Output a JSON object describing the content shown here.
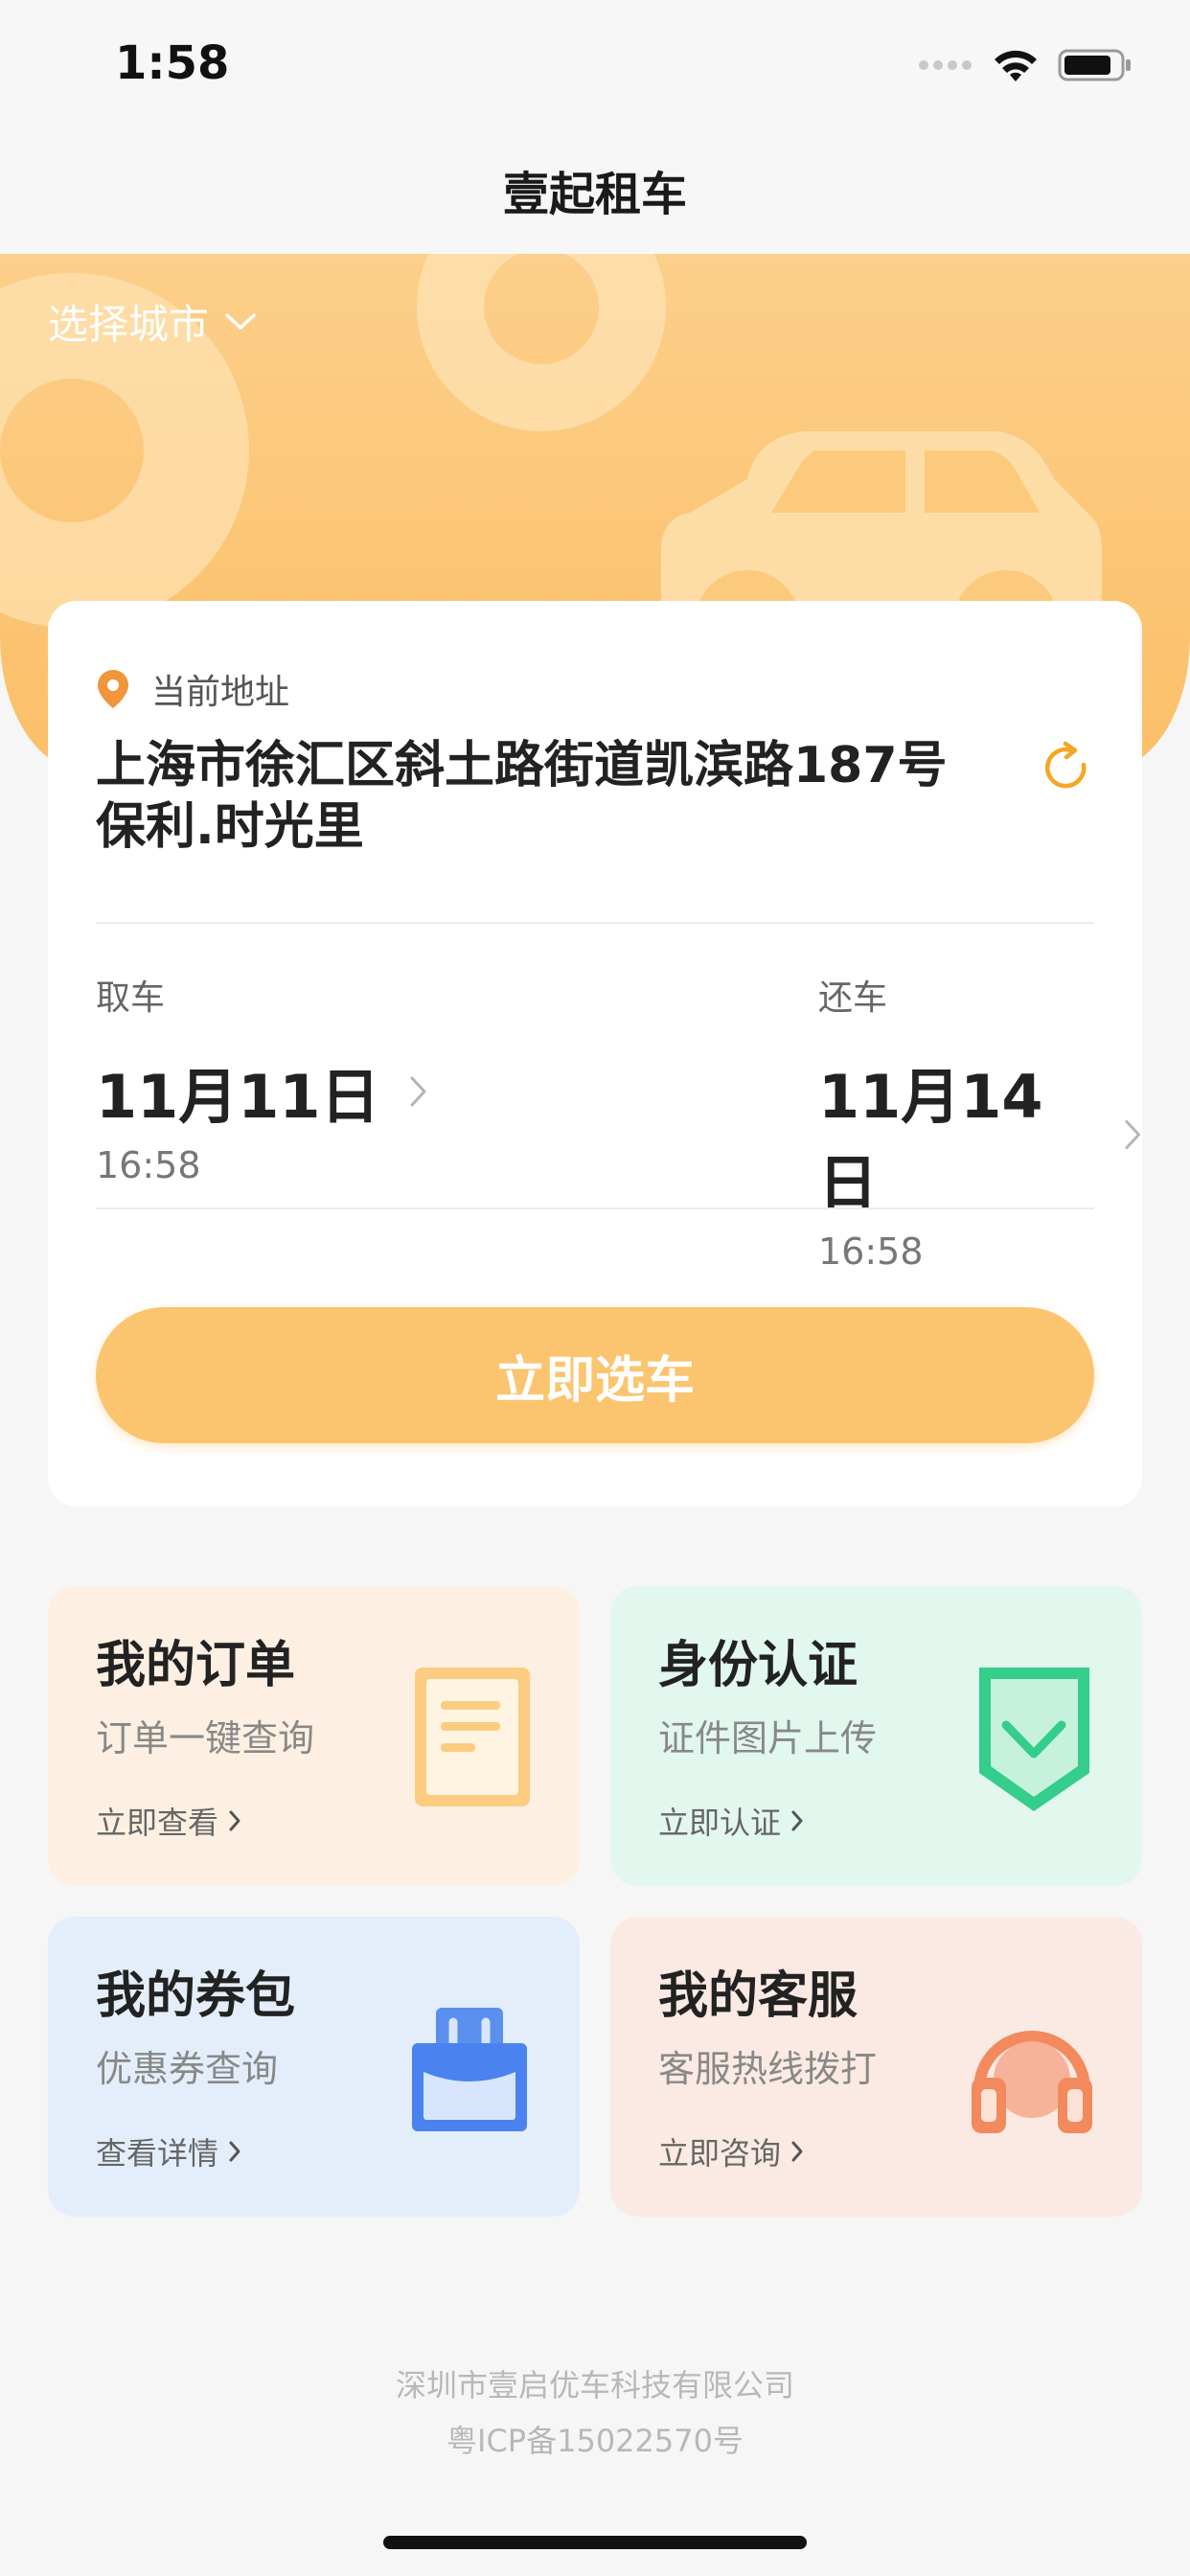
{
  "status": {
    "time": "1:58"
  },
  "nav": {
    "title": "壹起租车"
  },
  "banner": {
    "city_select": "选择城市"
  },
  "address": {
    "label": "当前地址",
    "line1": "上海市徐汇区斜土路街道凯滨路187号",
    "line2": "保利.时光里"
  },
  "pickup": {
    "label": "取车",
    "date": "11月11日",
    "time": "16:58"
  },
  "return": {
    "label": "还车",
    "date": "11月14日",
    "time": "16:58"
  },
  "cta": {
    "label": "立即选车"
  },
  "tiles": [
    {
      "title": "我的订单",
      "subtitle": "订单一键查询",
      "link": "立即查看"
    },
    {
      "title": "身份认证",
      "subtitle": "证件图片上传",
      "link": "立即认证"
    },
    {
      "title": "我的券包",
      "subtitle": "优惠券查询",
      "link": "查看详情"
    },
    {
      "title": "我的客服",
      "subtitle": "客服热线拨打",
      "link": "立即咨询"
    }
  ],
  "footer": {
    "company": "深圳市壹启优车科技有限公司",
    "icp": "粤ICP备15022570号"
  },
  "colors": {
    "accent": "#fbc56f",
    "banner": "#fccf8a",
    "orders_bg": "#fdf0e2",
    "verify_bg": "#e2f7ee",
    "coupon_bg": "#e4eefb",
    "service_bg": "#fbeae3"
  }
}
